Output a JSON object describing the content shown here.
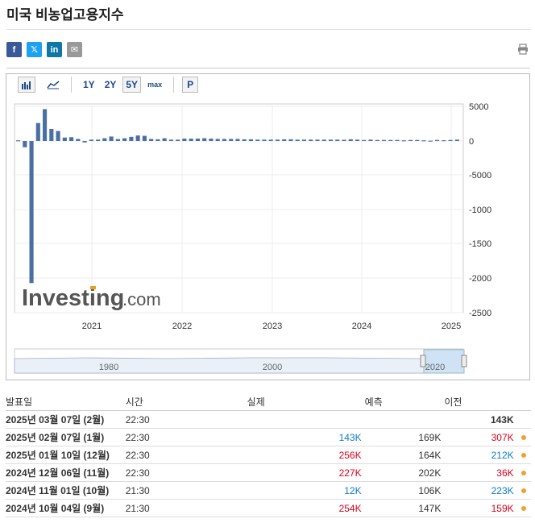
{
  "title": "미국 비농업고용지수",
  "share": [
    {
      "name": "facebook-button",
      "glyph": "f",
      "cls": "fb"
    },
    {
      "name": "twitter-button",
      "glyph": "𝕏",
      "cls": "tw"
    },
    {
      "name": "linkedin-button",
      "glyph": "in",
      "cls": "li"
    },
    {
      "name": "email-button",
      "glyph": "✉",
      "cls": "em"
    }
  ],
  "toolbar": {
    "ranges": [
      "1Y",
      "2Y",
      "5Y",
      "max"
    ],
    "selected": "5Y",
    "p_label": "P"
  },
  "watermark": {
    "brand": "Investing",
    "suffix": ".com"
  },
  "chart_data": {
    "type": "bar",
    "color": "#4a6fa5",
    "ylim": [
      -2500,
      5000
    ],
    "yticks": [
      5000,
      0,
      -5000,
      -1000,
      -1500,
      -2000,
      -2500
    ],
    "xticks": [
      "2021",
      "2022",
      "2023",
      "2024",
      "2025"
    ],
    "values": [
      100,
      -900,
      -20500,
      2600,
      4600,
      1750,
      1450,
      500,
      550,
      300,
      -200,
      200,
      200,
      400,
      650,
      280,
      400,
      600,
      800,
      750,
      300,
      250,
      400,
      200,
      200,
      350,
      350,
      350,
      400,
      350,
      300,
      300,
      300,
      300,
      250,
      250,
      200,
      200,
      200,
      200,
      250,
      250,
      200,
      200,
      200,
      200,
      200,
      200,
      200,
      180,
      250,
      200,
      150,
      200,
      150,
      150,
      150,
      150,
      100,
      150,
      150,
      100,
      50,
      150,
      120,
      150,
      200
    ]
  },
  "navigator": {
    "labels": [
      "1980",
      "2000",
      "2020"
    ]
  },
  "table": {
    "headers": [
      "발표일",
      "시간",
      "실제",
      "예측",
      "이전"
    ],
    "rows": [
      {
        "date": "2025년 03월 07일 (2월)",
        "time": "22:30",
        "actual": "",
        "actual_cls": "",
        "forecast": "",
        "previous": "143K",
        "prev_cls": "",
        "prev_bold": true,
        "dot": false
      },
      {
        "date": "2025년 02월 07일 (1월)",
        "time": "22:30",
        "actual": "143K",
        "actual_cls": "pos",
        "forecast": "169K",
        "previous": "307K",
        "prev_cls": "neg",
        "prev_bold": false,
        "dot": true
      },
      {
        "date": "2025년 01월 10일 (12월)",
        "time": "22:30",
        "actual": "256K",
        "actual_cls": "neg",
        "forecast": "164K",
        "previous": "212K",
        "prev_cls": "pos",
        "prev_bold": false,
        "dot": true
      },
      {
        "date": "2024년 12월 06일 (11월)",
        "time": "22:30",
        "actual": "227K",
        "actual_cls": "neg",
        "forecast": "202K",
        "previous": "36K",
        "prev_cls": "neg",
        "prev_bold": false,
        "dot": true
      },
      {
        "date": "2024년 11월 01일 (10월)",
        "time": "21:30",
        "actual": "12K",
        "actual_cls": "pos",
        "forecast": "106K",
        "previous": "223K",
        "prev_cls": "pos",
        "prev_bold": false,
        "dot": true
      },
      {
        "date": "2024년 10월 04일 (9월)",
        "time": "21:30",
        "actual": "254K",
        "actual_cls": "neg",
        "forecast": "147K",
        "previous": "159K",
        "prev_cls": "neg",
        "prev_bold": false,
        "dot": true
      }
    ]
  }
}
